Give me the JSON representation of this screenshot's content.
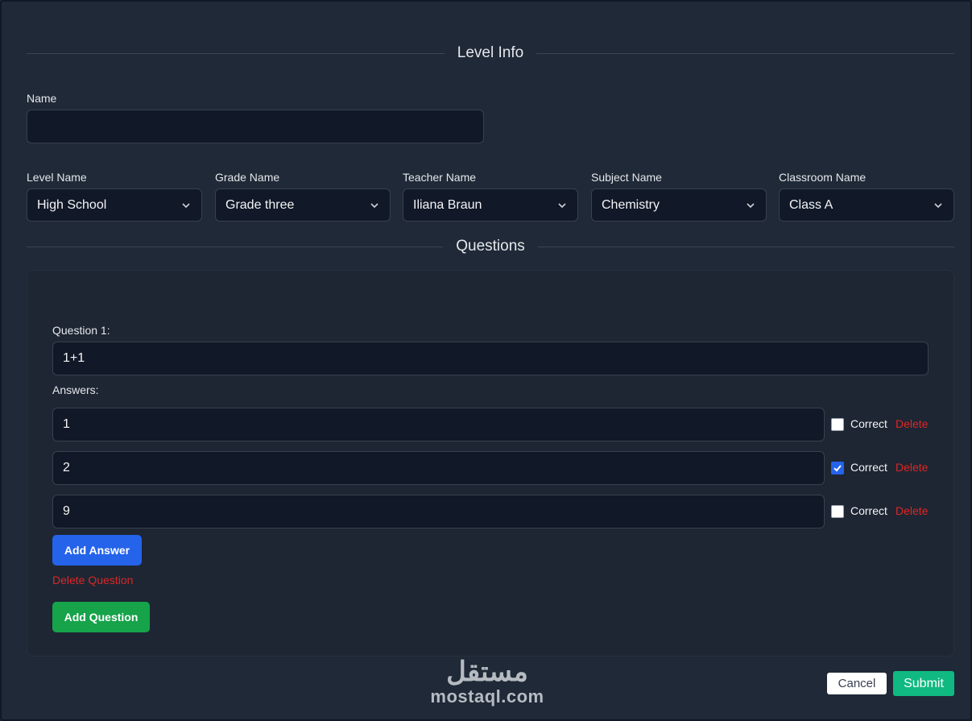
{
  "sections": {
    "level_info_title": "Level Info",
    "questions_title": "Questions"
  },
  "form": {
    "name_label": "Name",
    "name_value": "",
    "selects": [
      {
        "label": "Level Name",
        "value": "High School"
      },
      {
        "label": "Grade Name",
        "value": "Grade three"
      },
      {
        "label": "Teacher Name",
        "value": "Iliana Braun"
      },
      {
        "label": "Subject Name",
        "value": "Chemistry"
      },
      {
        "label": "Classroom Name",
        "value": "Class A"
      }
    ]
  },
  "question": {
    "label": "Question 1:",
    "value": "1+1",
    "answers_label": "Answers:",
    "answers": [
      {
        "value": "1",
        "correct": false,
        "correct_label": "Correct",
        "delete_label": "Delete"
      },
      {
        "value": "2",
        "correct": true,
        "correct_label": "Correct",
        "delete_label": "Delete"
      },
      {
        "value": "9",
        "correct": false,
        "correct_label": "Correct",
        "delete_label": "Delete"
      }
    ],
    "add_answer_label": "Add Answer",
    "delete_question_label": "Delete Question"
  },
  "actions": {
    "add_question_label": "Add Question",
    "cancel_label": "Cancel",
    "submit_label": "Submit"
  },
  "watermark": {
    "arabic": "مستقل",
    "latin": "mostaql.com"
  },
  "colors": {
    "background": "#1f2937",
    "input_bg": "#111827",
    "primary": "#2563eb",
    "success": "#16a34a",
    "submit": "#10b981",
    "danger": "#dc2626"
  }
}
